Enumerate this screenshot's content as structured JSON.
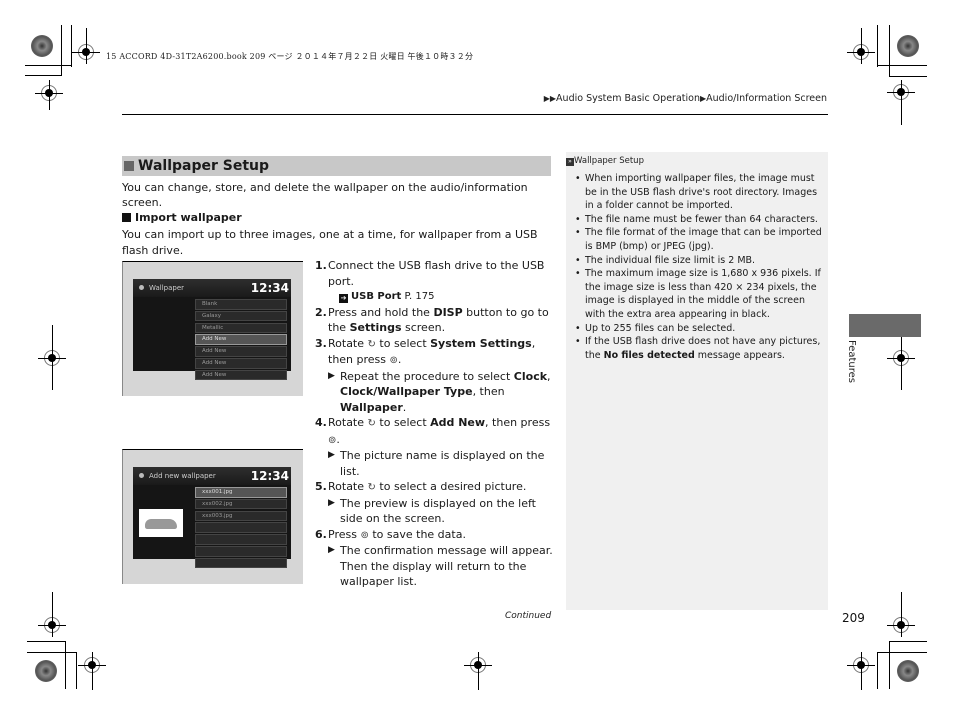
{
  "print_info": "15 ACCORD 4D-31T2A6200.book  209 ページ  ２０１４年７月２２日  火曜日  午後１０時３２分",
  "breadcrumb": [
    "Audio System Basic Operation",
    "Audio/Information Screen"
  ],
  "section": {
    "title": "Wallpaper Setup",
    "intro": "You can change, store, and delete the wallpaper on the audio/information screen."
  },
  "subsection": {
    "title": "Import wallpaper",
    "body": "You can import up to three images, one at a time, for wallpaper from a USB flash drive."
  },
  "screen1": {
    "title": "Wallpaper",
    "clock": "12:34",
    "items": [
      "Blank",
      "Galaxy",
      "Metallic",
      "Add New",
      "Add New",
      "Add New",
      "Add New"
    ],
    "selected_index": 3
  },
  "screen2": {
    "title": "Add new wallpaper",
    "clock": "12:34",
    "items": [
      "xxx001.jpg",
      "xxx002.jpg",
      "xxx003.jpg",
      "",
      "",
      "",
      ""
    ],
    "selected_index": 0
  },
  "steps": {
    "s1": {
      "num": "1.",
      "text": "Connect the USB flash drive to the USB port."
    },
    "s1_ref": {
      "label": "USB Port",
      "page": "P. 175"
    },
    "s2": {
      "num": "2.",
      "pre": "Press and hold the ",
      "b1": "DISP",
      "mid": " button to go to the ",
      "b2": "Settings",
      "post": " screen."
    },
    "s3": {
      "num": "3.",
      "pre": "Rotate ",
      "mid": " to select ",
      "b1": "System Settings",
      "post": ", then press ",
      "end": "."
    },
    "s3_res": {
      "pre": "Repeat the procedure to select ",
      "b1": "Clock",
      "sep": ", ",
      "b2": "Clock/Wallpaper Type",
      "mid": ", then ",
      "b3": "Wallpaper",
      "end": "."
    },
    "s4": {
      "num": "4.",
      "pre": "Rotate ",
      "mid": " to select ",
      "b1": "Add New",
      "post": ", then press ",
      "end": "."
    },
    "s4_res": "The picture name is displayed on the list.",
    "s5": {
      "num": "5.",
      "pre": "Rotate ",
      "post": " to select a desired picture."
    },
    "s5_res": "The preview is displayed on the left side on the screen.",
    "s6": {
      "num": "6.",
      "pre": "Press ",
      "post": " to save the data."
    },
    "s6_res": "The confirmation message will appear. Then the display will return to the wallpaper list."
  },
  "sidebar": {
    "title": "Wallpaper Setup",
    "notes": [
      "When importing wallpaper files, the image must be in the USB flash drive's root directory. Images in a folder cannot be imported.",
      "The file name must be fewer than 64 characters.",
      "The file format of the image that can be imported is BMP (bmp) or JPEG (jpg).",
      "The individual file size limit is 2 MB.",
      "The maximum image size is 1,680 x 936 pixels. If the image size is less than 420 × 234 pixels, the image is displayed in the middle of the screen with the extra area appearing in black.",
      "Up to 255 files can be selected."
    ],
    "last_note": {
      "pre": "If the USB flash drive does not have any pictures, the ",
      "b": "No files detected",
      "post": " message appears."
    }
  },
  "chapter_tab": "Features",
  "footer": {
    "continued": "Continued",
    "page_number": "209"
  },
  "icons": {
    "knob_rotate": "↻",
    "knob_press": "⊚",
    "ref_arrow": "➔",
    "result_triangle": "▶"
  }
}
